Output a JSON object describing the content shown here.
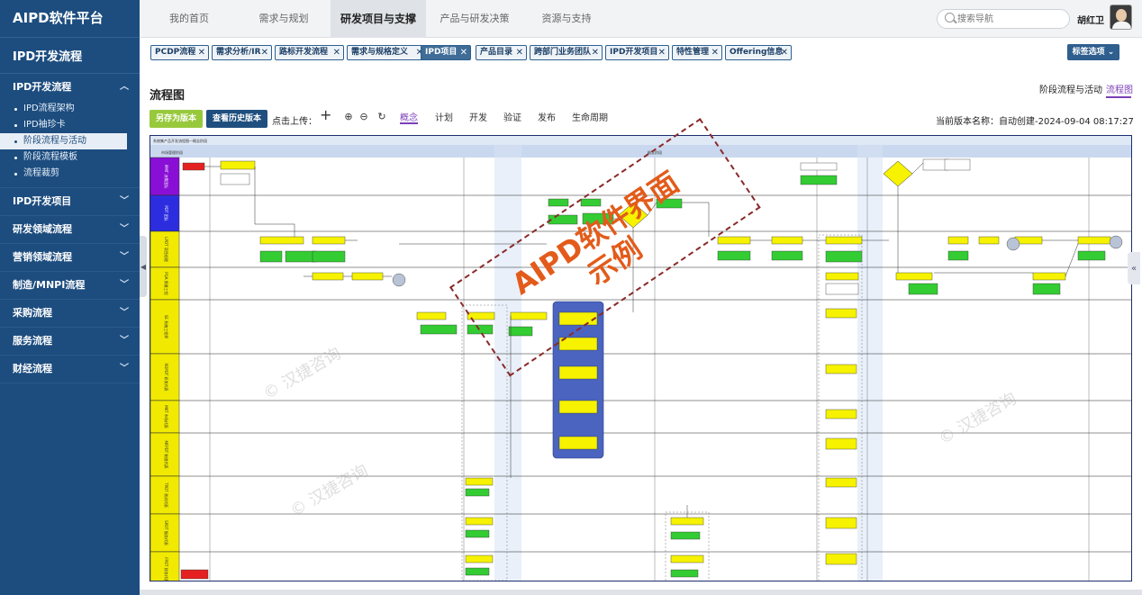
{
  "app": {
    "title": "AIPD软件平台",
    "section": "IPD开发流程"
  },
  "sidebar": {
    "groups": [
      {
        "label": "IPD开发流程",
        "expanded": true,
        "items": [
          "IPD流程架构",
          "IPD袖珍卡",
          "阶段流程与活动",
          "阶段流程模板",
          "流程裁剪"
        ],
        "active_index": 2
      },
      {
        "label": "IPD开发项目"
      },
      {
        "label": "研发领域流程"
      },
      {
        "label": "营销领域流程"
      },
      {
        "label": "制造/MNPI流程"
      },
      {
        "label": "采购流程"
      },
      {
        "label": "服务流程"
      },
      {
        "label": "财经流程"
      }
    ]
  },
  "topnav": {
    "tabs": [
      "我的首页",
      "需求与规划",
      "研发项目与支撑",
      "产品与研发决策",
      "资源与支持"
    ],
    "active_index": 2,
    "search_placeholder": "搜索导航",
    "user_name": "胡红卫"
  },
  "tags": {
    "items": [
      "PCDP流程",
      "需求分析/IR",
      "路标开发流程",
      "需求与规格定义",
      "IPD项目",
      "产品目录",
      "跨部门业务团队",
      "IPD开发项目",
      "特性管理",
      "Offering信息"
    ],
    "active_index": 4,
    "options_label": "标签选项"
  },
  "main": {
    "title": "流程图",
    "right_tabs": [
      "阶段流程与活动",
      "流程图"
    ],
    "right_active_index": 1,
    "save_button": "另存为版本",
    "history_button": "查看历史版本",
    "upload_label": "点击上传：",
    "stage_tabs": [
      "概念",
      "计划",
      "开发",
      "验证",
      "发布",
      "生命周期"
    ],
    "stage_active_index": 0,
    "version_label": "当前版本名称：",
    "version_value": "自动创建-2024-09-04 08:17:27"
  },
  "flowchart": {
    "watermark_text": [
      "AIPD软件界面",
      "示例"
    ],
    "faint_watermark": "© 汉捷咨询",
    "header_left": "市场管理阶段",
    "header_main": "概念阶段",
    "stripe_header": "系统集产品开发流程图—概念阶段",
    "lanes": [
      {
        "label": "IPMT 决策团队",
        "color": "#8a0fd6"
      },
      {
        "label": "PDT 团队",
        "color": "#2d2de0"
      },
      {
        "label": "LPDT 项目经理",
        "color": "#f1ea00"
      },
      {
        "label": "PQA 质量工程",
        "color": "#f1ea00"
      },
      {
        "label": "SE 系统工程师",
        "color": "#f1ea00"
      },
      {
        "label": "RDPDT 研发代表",
        "color": "#f1ea00"
      },
      {
        "label": "MKT 市场代表",
        "color": "#f1ea00"
      },
      {
        "label": "MFPDT 制造代表",
        "color": "#f1ea00"
      },
      {
        "label": "TPDT 测试代表",
        "color": "#f1ea00"
      },
      {
        "label": "SPDT 服务代表",
        "color": "#f1ea00"
      },
      {
        "label": "FPDT 财务代表",
        "color": "#f1ea00"
      }
    ],
    "colors": {
      "yellow": "#f6f200",
      "green": "#33cc33",
      "blue_panel": "#4a64c0",
      "lane_purple": "#8a0fd6",
      "lane_blue": "#2d2de0"
    }
  }
}
